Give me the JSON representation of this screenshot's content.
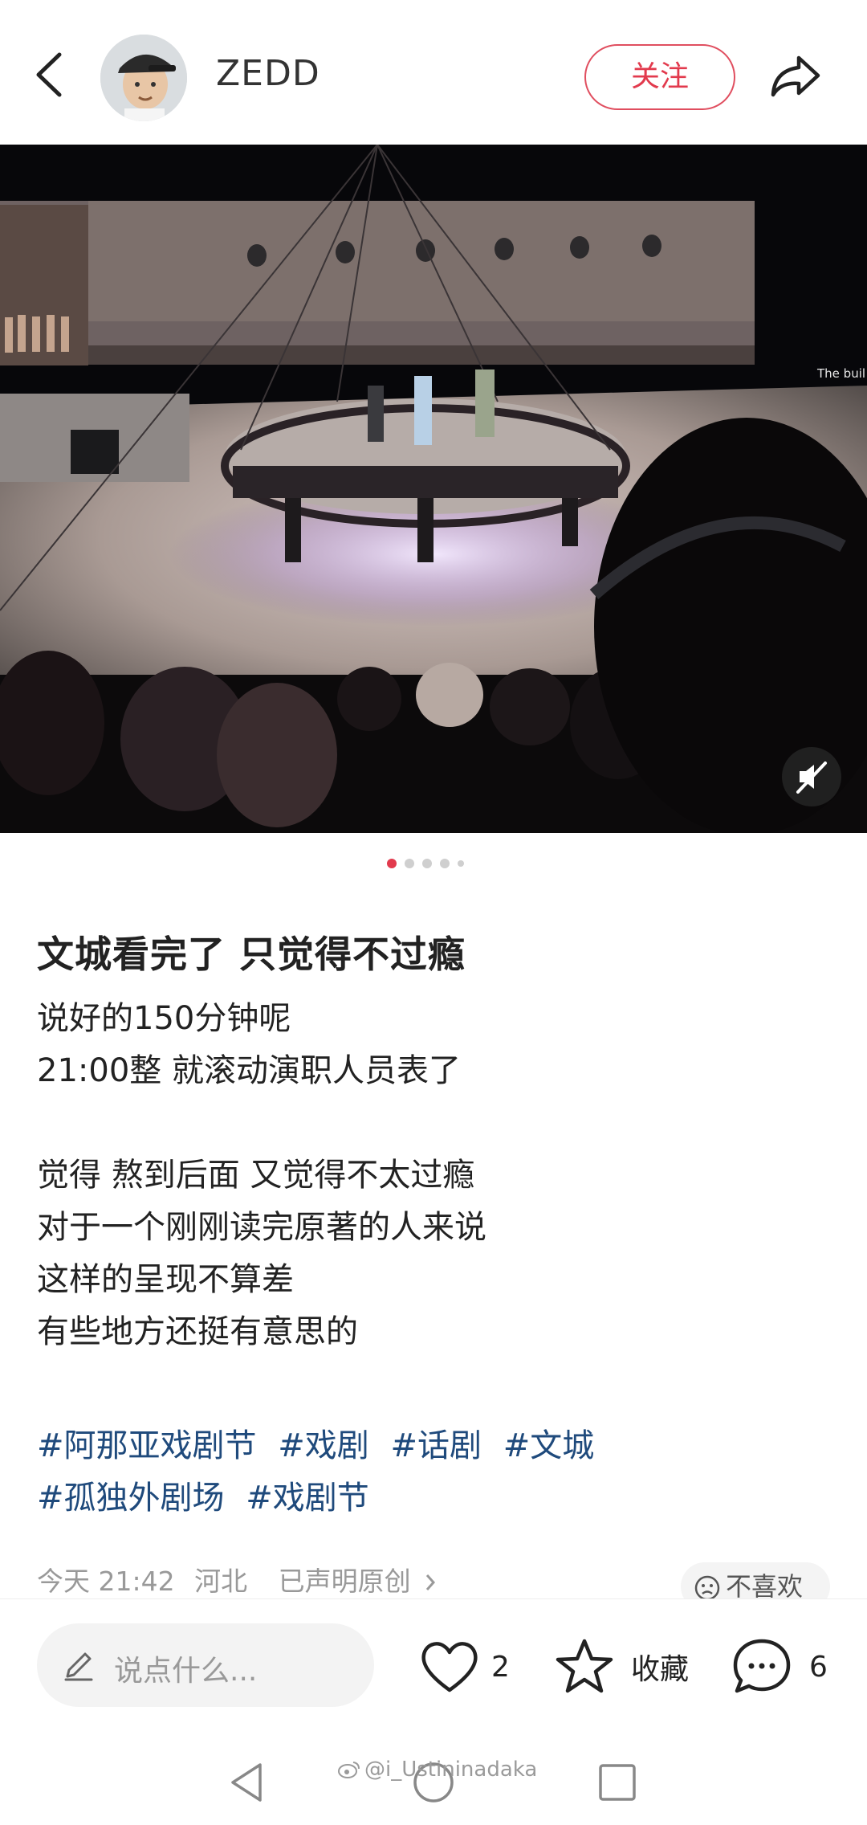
{
  "header": {
    "username": "ZEDD",
    "follow_label": "关注"
  },
  "post": {
    "image_count": 5,
    "active_image": 1,
    "title": "文城看完了 只觉得不过瘾",
    "lines": [
      "说好的150分钟呢",
      "21:00整 就滚动演职人员表了",
      "",
      "觉得 熬到后面 又觉得不太过瘾",
      "对于一个刚刚读完原著的人来说",
      "这样的呈现不算差",
      "有些地方还挺有意思的"
    ],
    "tag_rows": [
      [
        "#阿那亚戏剧节",
        "#戏剧",
        "#话剧",
        "#文城"
      ],
      [
        "#孤独外剧场",
        "#戏剧节"
      ]
    ],
    "meta": {
      "time": "今天 21:42",
      "location": "河北",
      "original": "已声明原创"
    },
    "dislike_label": "不喜欢"
  },
  "photo": {
    "screen_text": "The buil"
  },
  "bottom_bar": {
    "comment_placeholder": "说点什么...",
    "like_count": "2",
    "collect_label": "收藏",
    "comment_count": "6"
  },
  "watermark": "@i_Ustininadaka",
  "colors": {
    "accent": "#e23a4d",
    "tag": "#1f4a7c",
    "meta": "#999999"
  }
}
